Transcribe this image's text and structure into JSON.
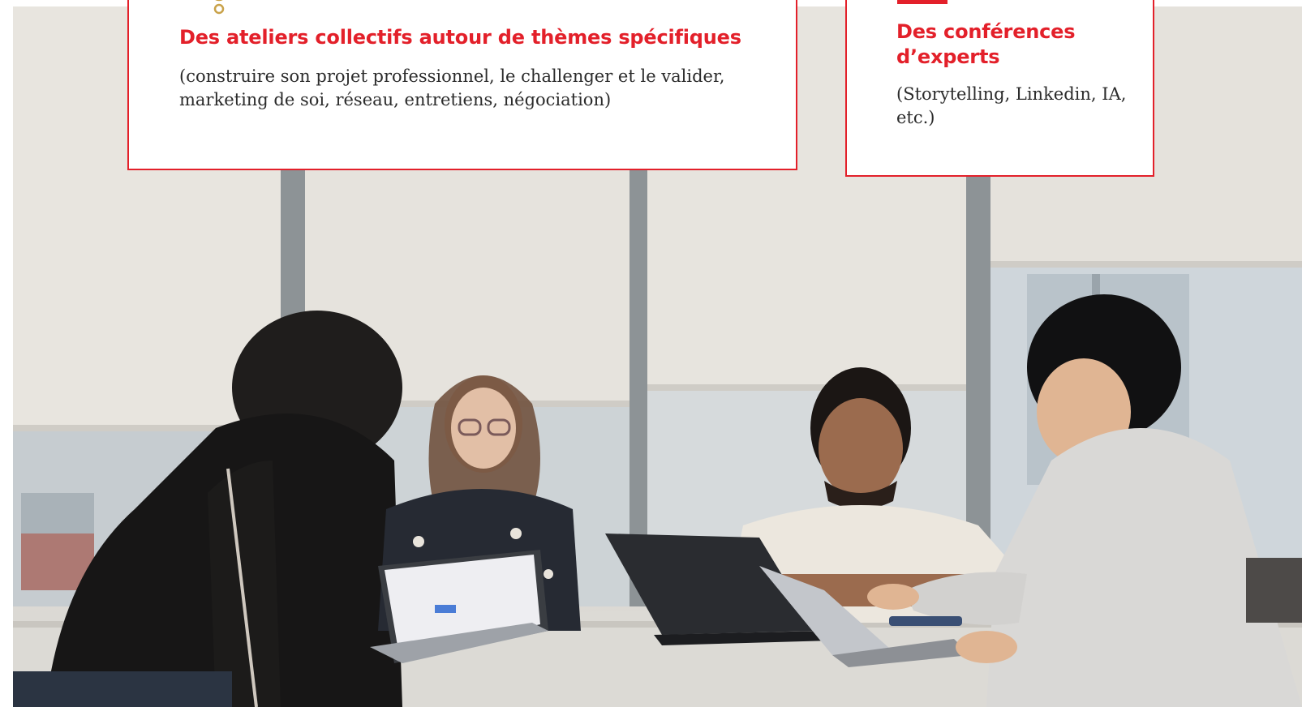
{
  "cards": {
    "workshops": {
      "title": "Des ateliers collectifs autour de thèmes spécifiques",
      "description": "(construire son projet professionnel, le challenger et le valider, marketing de soi, réseau, entretiens, négociation)",
      "icon": "medal-icon"
    },
    "conferences": {
      "title": "Des conférences d’experts",
      "description": "(Storytelling, Linkedin, IA, etc.)",
      "icon": "tag-icon"
    }
  },
  "colors": {
    "accent": "#e3202a",
    "body_text": "#2b2b2b",
    "icon_gold": "#c9a24a"
  }
}
